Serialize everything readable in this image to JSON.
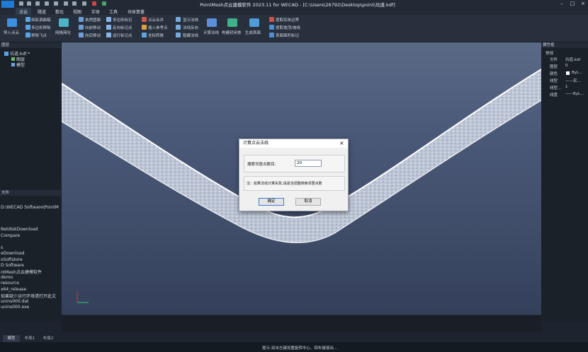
{
  "window": {
    "title": "PointMesh点云建模软件 2023.11 for WECAD - [C:\\Users\\26792\\Desktop\\point\\坑道.kdf]"
  },
  "menu": {
    "items": [
      "点云",
      "隧道",
      "数化",
      "视图",
      "实体",
      "工具",
      "块体算量"
    ]
  },
  "ribbon": {
    "import_label": "导入点云",
    "col1": [
      "拟影调曲稿",
      "多边形移除",
      "移除飞点"
    ],
    "mesh_label": "网格简化",
    "col2": [
      "依然固面",
      "向前移动",
      "向后移动"
    ],
    "col3": [
      "多边形标记",
      "反向标记点",
      "运行标记点"
    ],
    "col4": [
      "点云合并",
      "插入参考点",
      "坐标转换"
    ],
    "col5": [
      "显示法线",
      "法线反向",
      "隐藏法线"
    ],
    "normals_label": "计算法线",
    "build_label": "构建封闭体",
    "surface_label": "生成表面",
    "col6": [
      "提取实体边界",
      "提取坡顶/坡线",
      "表面面积标记"
    ]
  },
  "left_panel": {
    "layers_title": "图层",
    "tree_root": "坑道.kdf *",
    "tree_children": [
      "图层",
      "模型"
    ],
    "files_title": "文件",
    "files_path": "D:\\WECAD Software\\PointM",
    "files": [
      "NetdiskDownload",
      "Compare",
      "",
      "s",
      "eDownload",
      "oSoftstore",
      "D Software",
      "ntMesh点云建模软件",
      "demo",
      "resource",
      "x64_release",
      "如果缺少运行环境请打开此文",
      "unins000.dat",
      "unins000.exe"
    ]
  },
  "right_panel": {
    "title": "属性框",
    "group": "常规",
    "rows": [
      [
        "文件",
        "坑道.kdf"
      ],
      [
        "图层",
        "0"
      ],
      [
        "颜色",
        "ByL..."
      ],
      [
        "线型",
        "——实..."
      ],
      [
        "线型...",
        "1"
      ],
      [
        "线宽",
        "——ByL..."
      ]
    ]
  },
  "dialog": {
    "title": "计算点云法线",
    "search_label": "搜索邻居点数目:",
    "search_value": "20",
    "note": "注：如果法线计算失败,请适当调整搜索邻居点数",
    "ok_label": "确定",
    "cancel_label": "取消"
  },
  "tabs": [
    "模型",
    "布局1",
    "布局2"
  ],
  "status": {
    "hint": "提示:双击左键设置旋转中心、回车键退出..."
  },
  "colors": {
    "accent": "#1f7ad6",
    "viewport_top": "#5a6a86",
    "dialog_bg": "#f0f0f0"
  }
}
